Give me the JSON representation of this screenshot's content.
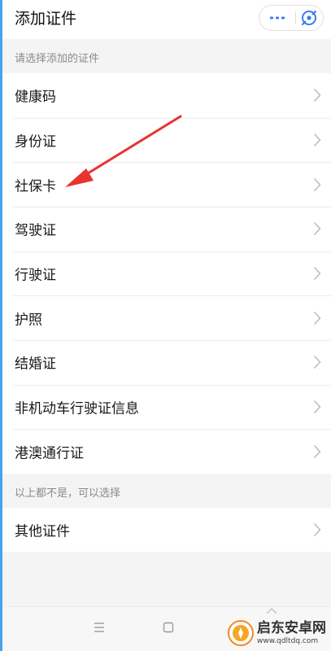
{
  "header": {
    "title": "添加证件",
    "more_icon": "more-dots-icon",
    "close_icon": "mini-program-close-icon",
    "accent_color": "#3a7bf2"
  },
  "section_select": {
    "label": "请选择添加的证件"
  },
  "cert_items": [
    {
      "label": "健康码"
    },
    {
      "label": "身份证"
    },
    {
      "label": "社保卡"
    },
    {
      "label": "驾驶证"
    },
    {
      "label": "行驶证"
    },
    {
      "label": "护照"
    },
    {
      "label": "结婚证"
    },
    {
      "label": "非机动车行驶证信息"
    },
    {
      "label": "港澳通行证"
    }
  ],
  "section_other": {
    "label": "以上都不是，可以选择"
  },
  "other_items": [
    {
      "label": "其他证件"
    }
  ],
  "system_nav": {
    "icons": [
      "menu-icon",
      "home-icon",
      "back-icon"
    ]
  },
  "annotation": {
    "arrow_color": "#e8332e",
    "points_to": "社保卡"
  },
  "watermark": {
    "name": "启东安卓网",
    "url": "www.qdltdq.com"
  }
}
